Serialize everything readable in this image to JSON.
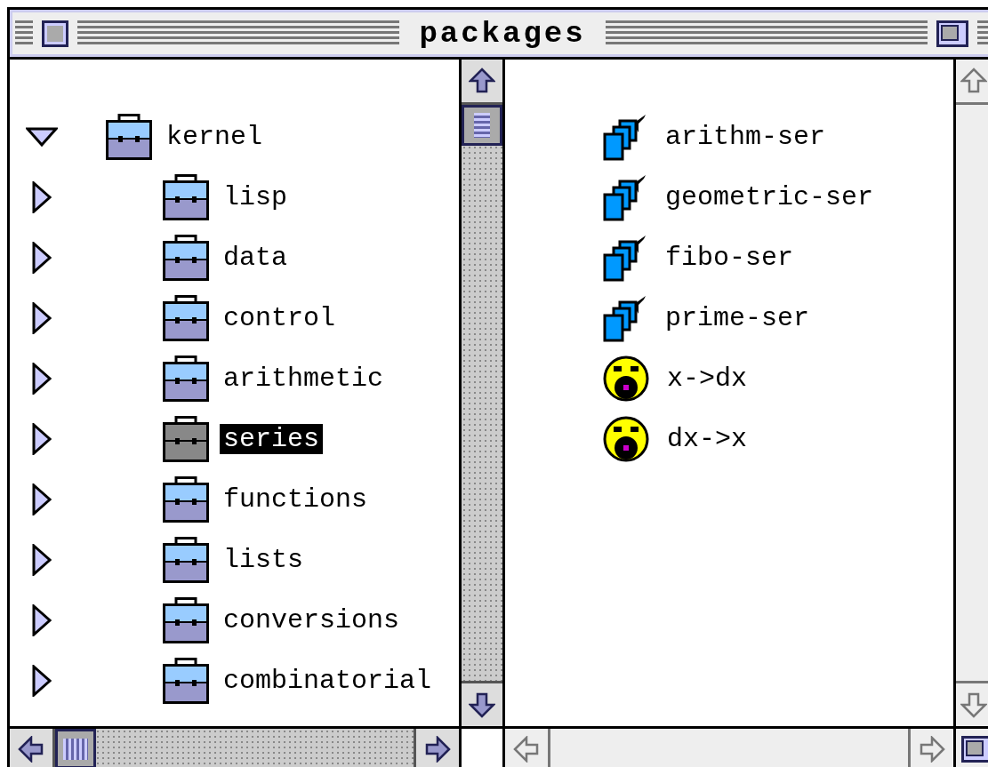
{
  "window": {
    "title": "packages"
  },
  "tree": [
    {
      "label": "kernel",
      "expanded": true,
      "selected": false,
      "children": [
        {
          "label": "lisp",
          "expanded": false,
          "selected": false
        },
        {
          "label": "data",
          "expanded": false,
          "selected": false
        },
        {
          "label": "control",
          "expanded": false,
          "selected": false
        },
        {
          "label": "arithmetic",
          "expanded": false,
          "selected": false
        },
        {
          "label": "series",
          "expanded": false,
          "selected": true
        },
        {
          "label": "functions",
          "expanded": false,
          "selected": false
        },
        {
          "label": "lists",
          "expanded": false,
          "selected": false
        },
        {
          "label": "conversions",
          "expanded": false,
          "selected": false
        },
        {
          "label": "combinatorial",
          "expanded": false,
          "selected": false
        }
      ]
    }
  ],
  "contents": [
    {
      "label": "arithm-ser",
      "kind": "generic"
    },
    {
      "label": "geometric-ser",
      "kind": "generic"
    },
    {
      "label": "fibo-ser",
      "kind": "generic"
    },
    {
      "label": "prime-ser",
      "kind": "generic"
    },
    {
      "label": "x->dx",
      "kind": "function"
    },
    {
      "label": "dx->x",
      "kind": "function"
    }
  ]
}
